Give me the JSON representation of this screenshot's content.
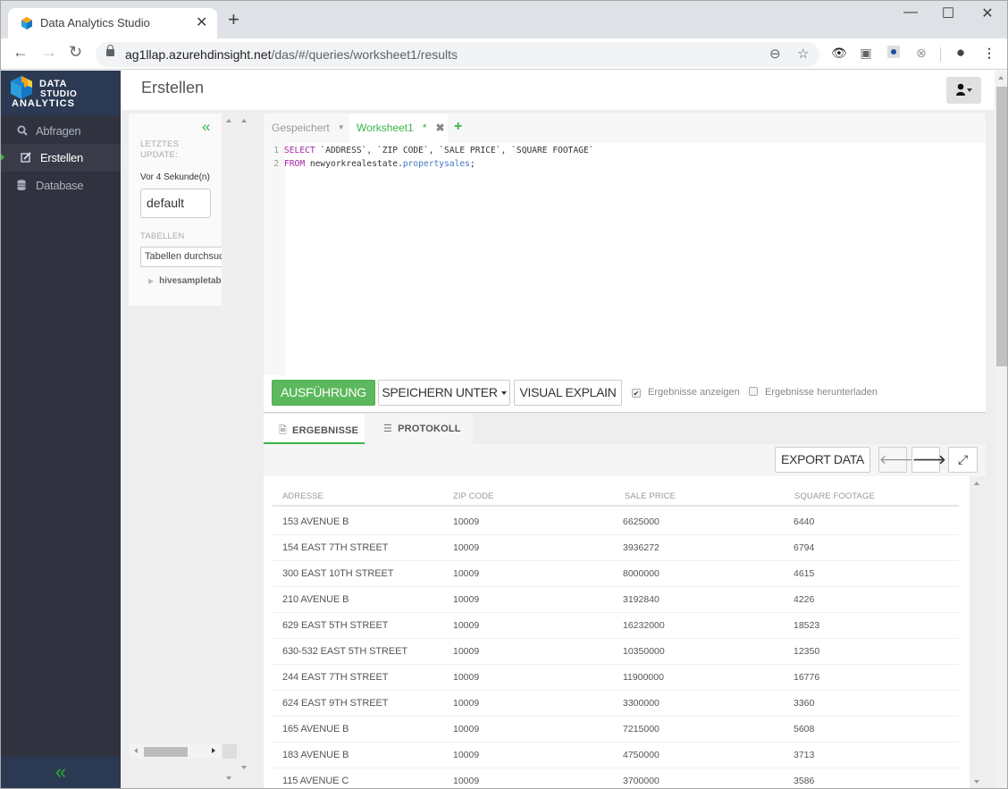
{
  "browser": {
    "tab_title": "Data Analytics Studio",
    "url_host": "ag1llap.azurehdinsight.net",
    "url_path": "/das/#/queries/worksheet1/results"
  },
  "brand": {
    "line1": "DATA",
    "line2": "STUDIO",
    "line3": "ANALYTICS",
    "accent": "#3cb44a"
  },
  "sidebar": {
    "items": [
      {
        "label": "Abfragen",
        "icon": "search-icon"
      },
      {
        "label": "Erstellen",
        "icon": "edit-icon",
        "active": true
      },
      {
        "label": "Database",
        "icon": "database-icon"
      }
    ]
  },
  "header": {
    "title": "Erstellen"
  },
  "dbpanel": {
    "last_update_label_1": "LETZTES",
    "last_update_label_2": "UPDATE:",
    "last_update_value": "Vor 4 Sekunde(n)",
    "database": "default",
    "tables_label": "TABELLEN",
    "tables_search_placeholder": "Tabellen durchsuchen",
    "tables": [
      "hivesampletable"
    ]
  },
  "editor": {
    "tabs": {
      "saved": "Gespeichert",
      "worksheet": "Worksheet1",
      "modified_marker": "*"
    },
    "lines": [
      {
        "n": "1",
        "kw": "SELECT",
        "rest": " `ADDRESS`, `ZIP CODE`, `SALE PRICE`, `SQUARE FOOTAGE`"
      },
      {
        "n": "2",
        "kw": "FROM",
        "db": " newyorkrealestate.",
        "tbl": "propertysales",
        "end": ";"
      }
    ]
  },
  "actions": {
    "run": "AUSFÜHRUNG",
    "save_as": "SPEICHERN UNTER",
    "visual_explain": "VISUAL EXPLAIN",
    "show_results": {
      "label": "Ergebnisse anzeigen",
      "checked": true
    },
    "download_results": {
      "label": "Ergebnisse herunterladen",
      "checked": false
    }
  },
  "results": {
    "tabs": [
      "ERGEBNISSE",
      "PROTOKOLL"
    ],
    "active_tab": "ERGEBNISSE",
    "export_label": "EXPORT DATA",
    "columns": [
      "ADRESSE",
      "ZIP CODE",
      "SALE PRICE",
      "SQUARE FOOTAGE"
    ],
    "rows": [
      [
        "153 AVENUE B",
        "10009",
        "6625000",
        "6440"
      ],
      [
        "154 EAST 7TH STREET",
        "10009",
        "3936272",
        "6794"
      ],
      [
        "300 EAST 10TH STREET",
        "10009",
        "8000000",
        "4615"
      ],
      [
        "210 AVENUE B",
        "10009",
        "3192840",
        "4226"
      ],
      [
        "629 EAST 5TH STREET",
        "10009",
        "16232000",
        "18523"
      ],
      [
        "630-532 EAST 5TH STREET",
        "10009",
        "10350000",
        "12350"
      ],
      [
        "244 EAST 7TH STREET",
        "10009",
        "11900000",
        "16776"
      ],
      [
        "624 EAST 9TH STREET",
        "10009",
        "3300000",
        "3360"
      ],
      [
        "165 AVENUE B",
        "10009",
        "7215000",
        "5608"
      ],
      [
        "183 AVENUE B",
        "10009",
        "4750000",
        "3713"
      ],
      [
        "115 AVENUE C",
        "10009",
        "3700000",
        "3586"
      ]
    ]
  }
}
